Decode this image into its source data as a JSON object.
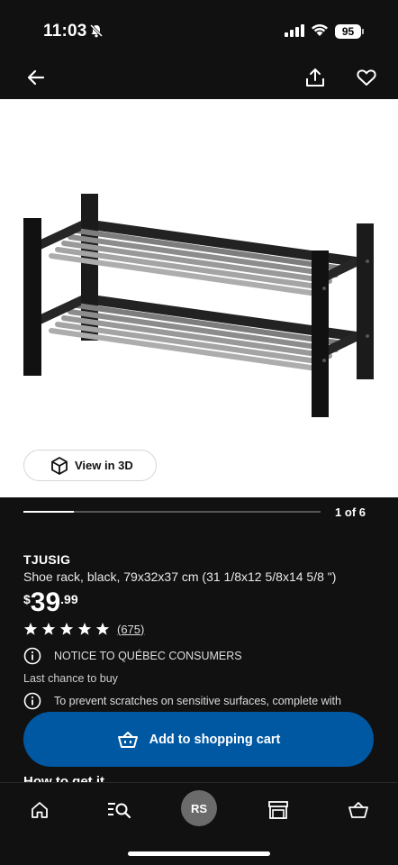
{
  "status_bar": {
    "time": "11:03",
    "battery": "95"
  },
  "header": {
    "back_icon": "arrow-left-icon",
    "share_icon": "share-icon",
    "favorite_icon": "heart-icon"
  },
  "gallery": {
    "view_3d_label": "View in 3D",
    "counter": "1 of 6",
    "progress_fraction": 0.17
  },
  "product": {
    "brand": "TJUSIG",
    "description": "Shoe rack, black, 79x32x37 cm (31 1/8x12 5/8x14 5/8 \")",
    "price": {
      "currency": "$",
      "integer": "39",
      "decimal": ".99"
    },
    "rating": {
      "stars": 5,
      "count": "(675)"
    },
    "notice_1": "NOTICE TO QUÉBEC CONSUMERS",
    "last_chance": "Last chance to buy",
    "notice_2": "To prevent scratches on sensitive surfaces, complete with"
  },
  "cart": {
    "label": "Add to shopping cart"
  },
  "peek": {
    "text": "How to get it"
  },
  "tab_bar": {
    "avatar_initials": "RS"
  },
  "colors": {
    "background": "#111111",
    "accent": "#0058a3",
    "avatar": "#6b6b6b"
  }
}
